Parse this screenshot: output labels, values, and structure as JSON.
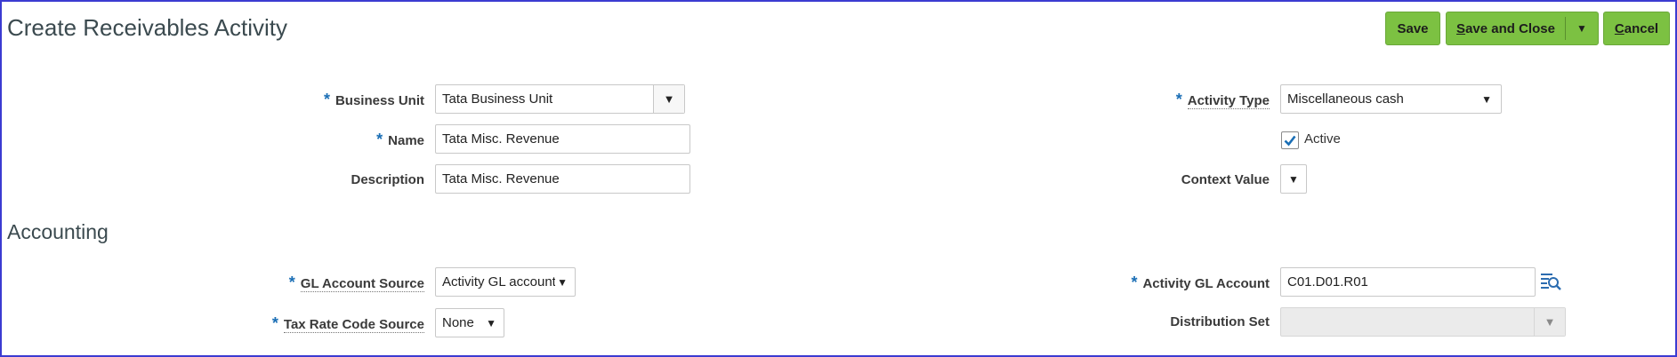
{
  "page_title": "Create Receivables Activity",
  "toolbar": {
    "save_label": "Save",
    "save_close_prefix": "S",
    "save_close_rest": "ave and Close",
    "cancel_prefix": "C",
    "cancel_rest": "ancel"
  },
  "form": {
    "business_unit": {
      "label": "Business Unit",
      "value": "Tata Business Unit"
    },
    "name": {
      "label": "Name",
      "value": "Tata Misc. Revenue"
    },
    "description": {
      "label": "Description",
      "value": "Tata Misc. Revenue"
    },
    "activity_type": {
      "label": "Activity Type",
      "value": "Miscellaneous cash"
    },
    "active": {
      "label": "Active",
      "checked": true
    },
    "context_value": {
      "label": "Context Value",
      "value": ""
    }
  },
  "accounting": {
    "title": "Accounting",
    "gl_account_source": {
      "label": "GL Account Source",
      "value": "Activity GL account"
    },
    "tax_rate_code_source": {
      "label": "Tax Rate Code Source",
      "value": "None"
    },
    "activity_gl_account": {
      "label": "Activity GL Account",
      "value": "C01.D01.R01"
    },
    "distribution_set": {
      "label": "Distribution Set",
      "value": ""
    }
  },
  "colors": {
    "button_green": "#7cc142",
    "required_asterisk": "#1a6eb5",
    "title_text": "#3b4a4f"
  }
}
